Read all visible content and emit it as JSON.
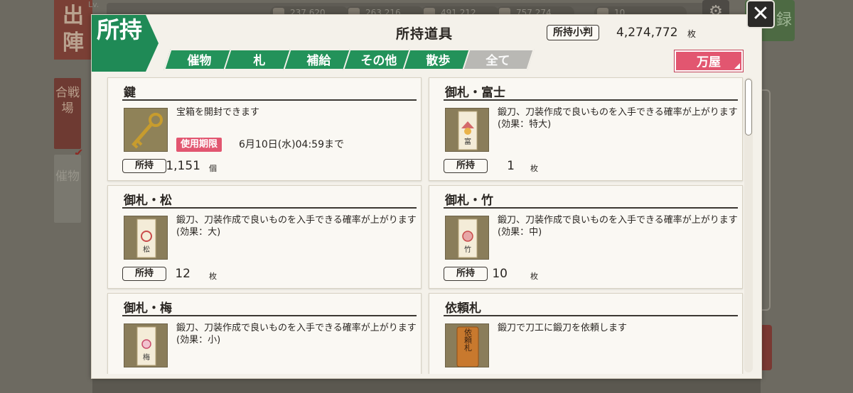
{
  "background": {
    "shutsujin": "出陣",
    "level_prefix": "Lv.",
    "side_tabs": [
      "合戦場",
      "催物"
    ],
    "resources": [
      "237,620",
      "263,216",
      "491,212",
      "757,274"
    ],
    "level_value": "10",
    "green_button": "録"
  },
  "close_label": "✕",
  "header": {
    "tag": "所持",
    "title": "所持道具",
    "koban_label": "所持小判",
    "koban_value": "4,274,772",
    "koban_unit": "枚"
  },
  "tabs": [
    {
      "label": "催物",
      "active": true
    },
    {
      "label": "札",
      "active": true
    },
    {
      "label": "補給",
      "active": true
    },
    {
      "label": "その他",
      "active": true
    },
    {
      "label": "散歩",
      "active": true
    },
    {
      "label": "全て",
      "active": false
    }
  ],
  "shop_button": "万屋",
  "owned_label": "所持",
  "items": [
    {
      "name": "鍵",
      "desc": "宝箱を開封できます",
      "expiry_badge": "使用期限",
      "expiry_text": "6月10日(水)04:59まで",
      "count": "1,151",
      "unit": "個",
      "icon": "key-icon"
    },
    {
      "name": "御札・富士",
      "desc": "鍛刀、刀装作成で良いものを入手できる確率が上がります(効果：特大)",
      "count": "1",
      "unit": "枚",
      "icon": "talisman-fuji-icon",
      "charm": "富"
    },
    {
      "name": "御札・松",
      "desc": "鍛刀、刀装作成で良いものを入手できる確率が上がります(効果：大)",
      "count": "12",
      "unit": "枚",
      "icon": "talisman-matsu-icon",
      "charm": "松"
    },
    {
      "name": "御札・竹",
      "desc": "鍛刀、刀装作成で良いものを入手できる確率が上がります(効果：中)",
      "count": "10",
      "unit": "枚",
      "icon": "talisman-take-icon",
      "charm": "竹"
    },
    {
      "name": "御札・梅",
      "desc": "鍛刀、刀装作成で良いものを入手できる確率が上がります(効果：小)",
      "count": "",
      "unit": "",
      "icon": "talisman-ume-icon",
      "charm": "梅"
    },
    {
      "name": "依頼札",
      "desc": "鍛刀で刀工に鍛刀を依頼します",
      "count": "",
      "unit": "",
      "icon": "request-tag-icon",
      "charm": "依頼札"
    }
  ],
  "colors": {
    "accent_green": "#23925a",
    "accent_pink": "#e25670",
    "panel": "#f4f1ea"
  }
}
